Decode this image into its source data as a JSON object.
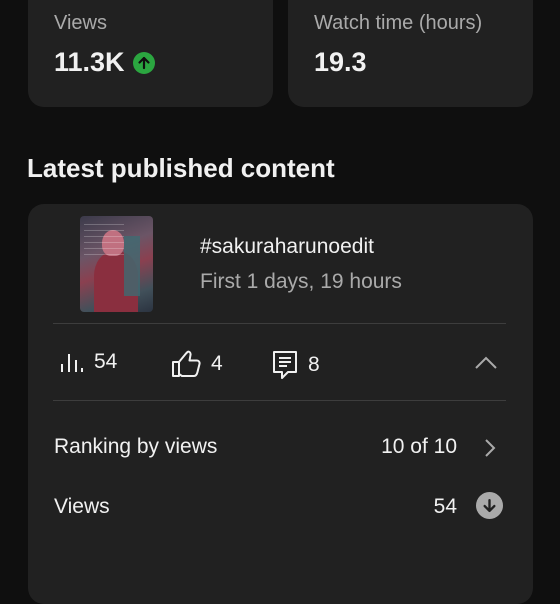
{
  "stats": {
    "views": {
      "label": "Views",
      "value": "11.3K",
      "trend_icon": "arrow-up-circle-icon",
      "trend_color": "#2ba640"
    },
    "watch_time": {
      "label": "Watch time (hours)",
      "value": "19.3"
    }
  },
  "section_title": "Latest published content",
  "latest": {
    "title": "#sakuraharunoedit",
    "subtitle": "First 1 days, 19 hours",
    "metrics": {
      "views": {
        "icon": "bar-chart-icon",
        "value": "54"
      },
      "likes": {
        "icon": "thumbs-up-icon",
        "value": "4"
      },
      "comments": {
        "icon": "comment-icon",
        "value": "8"
      }
    },
    "collapse_icon": "chevron-up-icon",
    "ranking": {
      "label": "Ranking by views",
      "value": "10 of 10",
      "icon": "chevron-right-icon"
    },
    "views_row": {
      "label": "Views",
      "value": "54",
      "trend_icon": "arrow-down-circle-icon"
    }
  },
  "colors": {
    "background": "#0f0f0f",
    "card": "#212121",
    "up": "#2ba640",
    "down": "#aaaaaa"
  }
}
